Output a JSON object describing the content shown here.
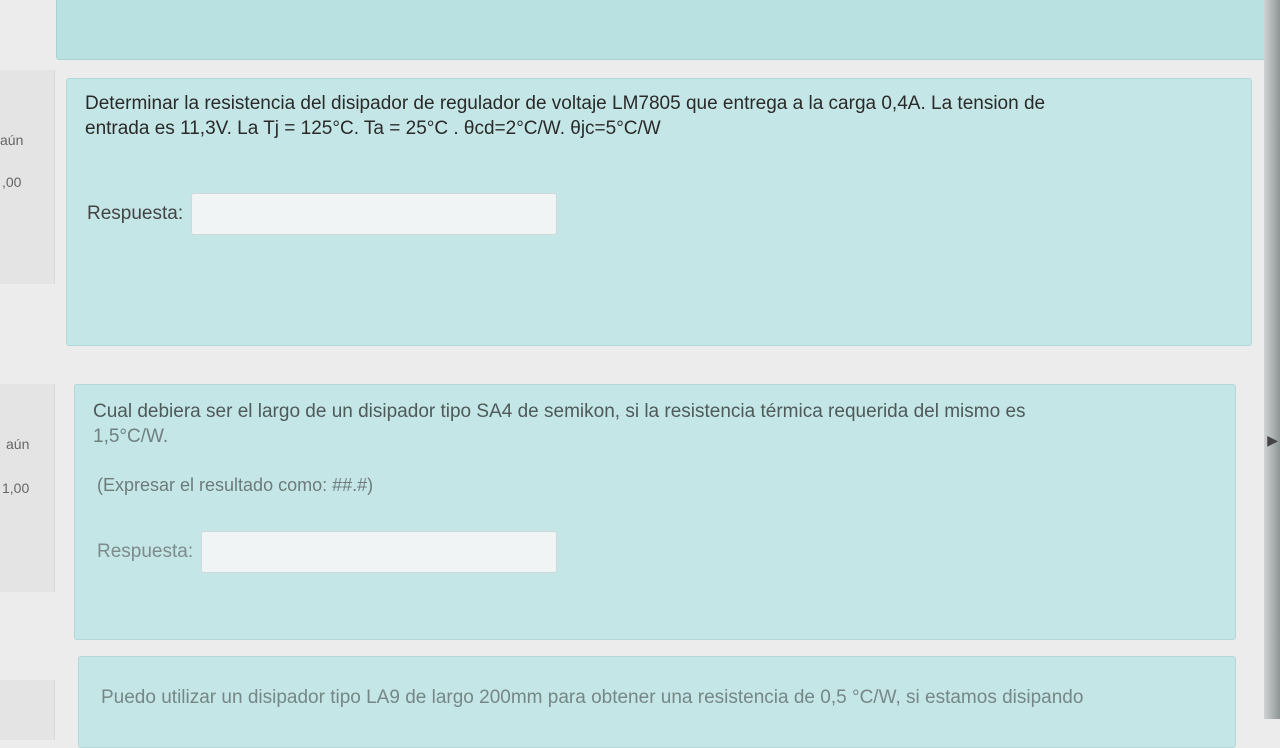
{
  "questions": [
    {
      "info": {
        "status": "aún",
        "points": ",00"
      },
      "text_line1": "Determinar la resistencia del disipador de regulador de voltaje LM7805 que entrega a la carga 0,4A. La tension de",
      "text_line2": "entrada es 11,3V. La Tj = 125°C. Ta = 25°C . θcd=2°C/W. θjc=5°C/W",
      "answer_label": "Respuesta:",
      "answer_value": ""
    },
    {
      "info": {
        "status": "aún",
        "points": "1,00"
      },
      "text_line1": "Cual debiera ser el largo de un disipador tipo SA4 de semikon, si la resistencia térmica requerida del mismo es",
      "text_line2": "1,5°C/W.",
      "hint": "(Expresar el resultado como: ##.#)",
      "answer_label": "Respuesta:",
      "answer_value": ""
    },
    {
      "text_line1": "Puedo utilizar un disipador tipo LA9 de largo 200mm para obtener una resistencia de 0,5 °C/W, si estamos disipando"
    }
  ]
}
